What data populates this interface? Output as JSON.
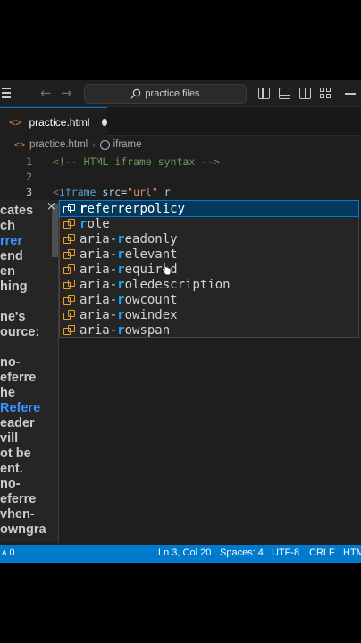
{
  "titlebar": {
    "search_label": "practice files"
  },
  "tab": {
    "icon_glyph": "<>",
    "label": "practice.html"
  },
  "breadcrumb": {
    "file": "practice.html",
    "element": "iframe"
  },
  "editor": {
    "lines": [
      {
        "number": "1",
        "comment": "<!-- HTML iframe syntax -->"
      },
      {
        "number": "2"
      },
      {
        "number": "3",
        "tag": "iframe",
        "attr": "src",
        "value": "\"url\"",
        "typed": "r"
      }
    ]
  },
  "hover_doc": {
    "lines": [
      "cates",
      "ch",
      "rrer",
      "end",
      "en",
      "hing",
      "",
      "ne's",
      "ource:",
      "",
      "no-",
      "eferre",
      "he",
      "Refere",
      "eader",
      "vill",
      "ot be",
      "ent.",
      "no-",
      "eferre",
      "vhen-",
      "owngra"
    ],
    "link_lines": [
      2,
      13
    ],
    "close_label": "×"
  },
  "suggestions": [
    {
      "pre": "",
      "hl": "r",
      "post": "eferrerpolicy",
      "selected": true
    },
    {
      "pre": "",
      "hl": "r",
      "post": "ole",
      "selected": false
    },
    {
      "pre": "aria-",
      "hl": "r",
      "post": "eadonly",
      "selected": false
    },
    {
      "pre": "aria-",
      "hl": "r",
      "post": "elevant",
      "selected": false
    },
    {
      "pre": "aria-",
      "hl": "r",
      "post": "equired",
      "selected": false
    },
    {
      "pre": "aria-",
      "hl": "r",
      "post": "oledescription",
      "selected": false
    },
    {
      "pre": "aria-",
      "hl": "r",
      "post": "owcount",
      "selected": false
    },
    {
      "pre": "aria-",
      "hl": "r",
      "post": "owindex",
      "selected": false
    },
    {
      "pre": "aria-",
      "hl": "r",
      "post": "owspan",
      "selected": false
    }
  ],
  "statusbar": {
    "left": "ʌ 0",
    "position": "Ln 3, Col 20",
    "spaces": "Spaces: 4",
    "encoding": "UTF-8",
    "eol": "CRLF",
    "language": "HTML"
  },
  "colors": {
    "accent": "#007acc",
    "selection": "#04395e",
    "match_highlight": "#18a3ff"
  }
}
